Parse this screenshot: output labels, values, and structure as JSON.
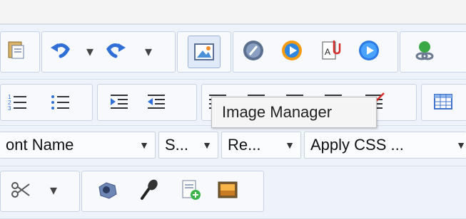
{
  "tooltip": {
    "text": "Image Manager"
  },
  "selects": {
    "font_name": "ont Name",
    "size": "S...",
    "paragraph": "Re...",
    "css_class": "Apply CSS ..."
  },
  "icons": {
    "row1": [
      "paste-icon",
      "undo-icon",
      "redo-icon",
      "image-manager-icon",
      "flash-icon",
      "media-icon",
      "document-manager-icon",
      "play-icon",
      "link-icon"
    ],
    "row2": [
      "numbered-list-icon",
      "bullet-list-icon",
      "indent-icon",
      "outdent-icon",
      "align-left-icon",
      "align-center-icon",
      "align-right-icon",
      "justify-icon",
      "strike-align-icon",
      "table-icon"
    ],
    "row4": [
      "eraser-icon",
      "webcam-icon",
      "microphone-icon",
      "new-document-icon",
      "image-icon"
    ]
  },
  "colors": {
    "toolbar_bg": "#eef3fb",
    "tooltip_bg": "#f5f5f5",
    "accent_blue": "#2f6fd6"
  }
}
